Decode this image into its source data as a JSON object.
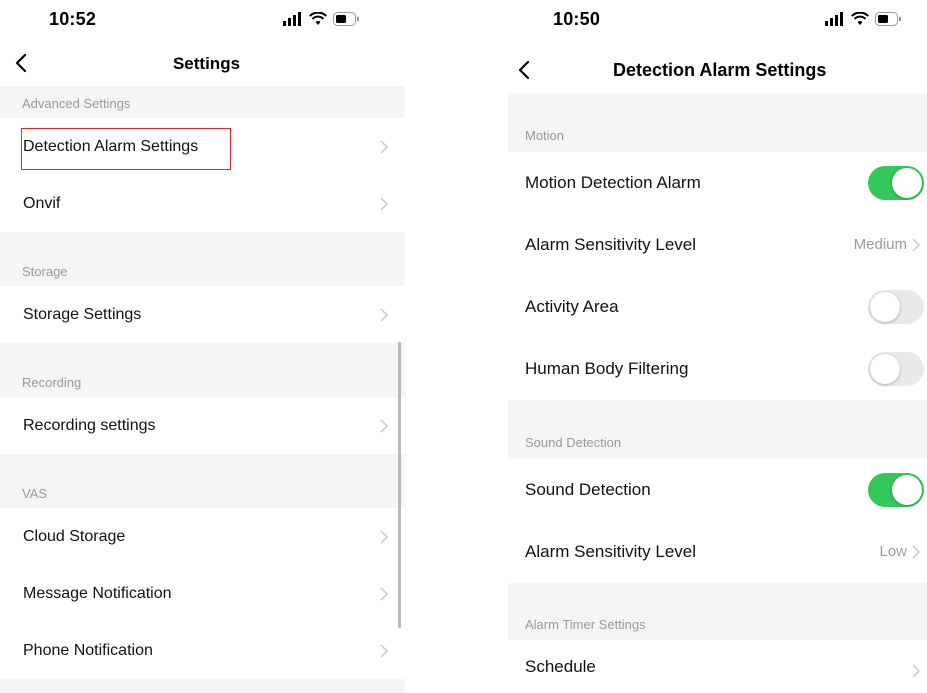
{
  "left_screen": {
    "status": {
      "time": "10:52"
    },
    "nav": {
      "title": "Settings"
    },
    "sections": {
      "advanced": "Advanced Settings",
      "storage": "Storage",
      "recording": "Recording",
      "vas": "VAS"
    },
    "items": {
      "detection_alarm": "Detection Alarm Settings",
      "onvif": "Onvif",
      "storage_settings": "Storage Settings",
      "recording_settings": "Recording settings",
      "cloud_storage": "Cloud Storage",
      "message_notification": "Message Notification",
      "phone_notification": "Phone Notification"
    }
  },
  "right_screen": {
    "status": {
      "time": "10:50"
    },
    "nav": {
      "title": "Detection Alarm Settings"
    },
    "sections": {
      "motion": "Motion",
      "sound": "Sound Detection",
      "timer": "Alarm Timer Settings"
    },
    "items": {
      "motion_detection_alarm": {
        "label": "Motion Detection Alarm",
        "enabled": true
      },
      "motion_sensitivity": {
        "label": "Alarm Sensitivity Level",
        "value": "Medium"
      },
      "activity_area": {
        "label": "Activity Area",
        "enabled": false
      },
      "human_body_filtering": {
        "label": "Human Body Filtering",
        "enabled": false
      },
      "sound_detection": {
        "label": "Sound Detection",
        "enabled": true
      },
      "sound_sensitivity": {
        "label": "Alarm Sensitivity Level",
        "value": "Low"
      },
      "schedule": {
        "label": "Schedule"
      }
    }
  },
  "colors": {
    "toggle_on": "#34c759",
    "toggle_off": "#e9e9ea",
    "section_bg": "#f5f5f5",
    "highlight": "#e0262b"
  },
  "icons": {
    "back": "chevron-left-icon",
    "disclosure": "chevron-right-icon",
    "signal": "signal-icon",
    "wifi": "wifi-icon",
    "battery": "battery-icon"
  }
}
